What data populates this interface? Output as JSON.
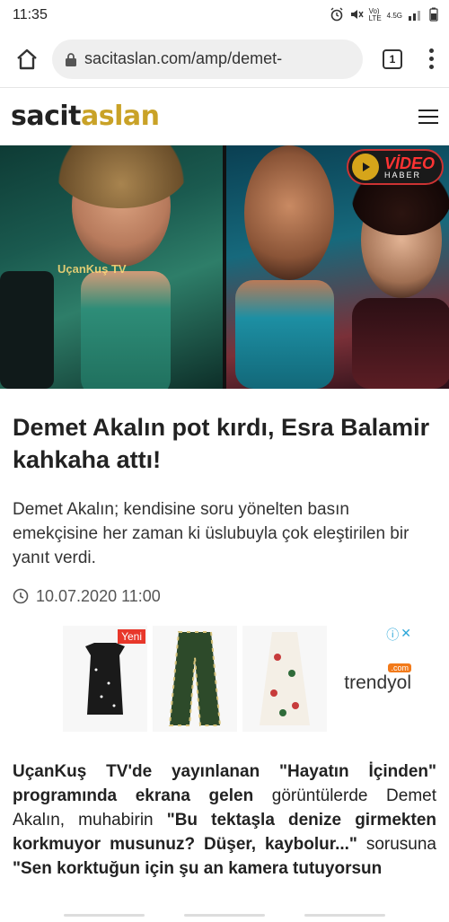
{
  "status_bar": {
    "time": "11:35",
    "network_top": "Vo)",
    "network_bottom": "LTE",
    "data_type": "4.5G"
  },
  "browser": {
    "url": "sacitaslan.com/amp/demet-",
    "tab_count": "1"
  },
  "site": {
    "logo_part1": "sacit",
    "logo_part2": "aslan"
  },
  "hero": {
    "watermark": "UçanKuş TV",
    "badge_title": "VİDEO",
    "badge_sub": "HABER"
  },
  "article": {
    "title": "Demet Akalın pot kırdı, Esra Balamir kahkaha attı!",
    "lead": "Demet Akalın; kendisine soru yönelten basın emekçisine her zaman ki üslubuyla çok eleştirilen bir yanıt verdi.",
    "date": "10.07.2020 11:00",
    "body_p1_bold": "UçanKuş TV'de yayınlanan \"Hayatın İçinden\" programında ekrana gelen",
    "body_p1_normal": " görüntülerde Demet Akalın, muhabirin ",
    "body_p1_quote": "\"Bu tektaşla denize girmekten korkmuyor musunuz? Düşer, kaybolur...\"",
    "body_p1_tail": " sorusuna ",
    "body_p1_answer": "\"Sen korktuğun için şu an kamera tutuyorsun"
  },
  "ad": {
    "badge": "Yeni",
    "brand": "trendyol",
    "brand_sup": ".com"
  },
  "colors": {
    "accent": "#c9a227",
    "ad_badge": "#e8372a"
  }
}
